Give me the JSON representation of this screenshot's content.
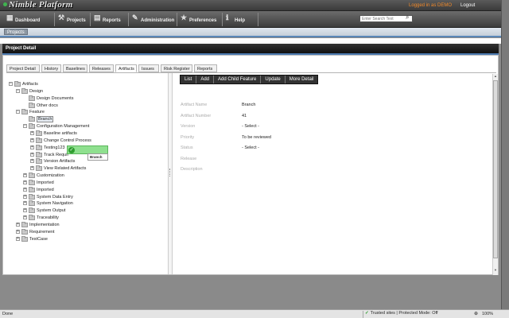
{
  "app": {
    "logo": "Nimble Platform",
    "login_info": "Logged in as DEMO",
    "logout": "Logout"
  },
  "nav": [
    {
      "label": "Dashboard",
      "icon": "dashboard-icon",
      "glyph": "▦"
    },
    {
      "label": "Projects",
      "icon": "projects-icon",
      "glyph": "⚒"
    },
    {
      "label": "Reports",
      "icon": "reports-icon",
      "glyph": "▤"
    },
    {
      "label": "Administration",
      "icon": "administration-icon",
      "glyph": "✎"
    },
    {
      "label": "Preferences",
      "icon": "preferences-icon",
      "glyph": "★"
    },
    {
      "label": "Help",
      "icon": "help-icon",
      "glyph": "ℹ"
    }
  ],
  "search": {
    "placeholder": "Enter Search Text"
  },
  "breadcrumb": {
    "current": "Projects"
  },
  "panel": {
    "title": "Project Detail"
  },
  "tabs": [
    {
      "label": "Project Detail"
    },
    {
      "label": "History"
    },
    {
      "label": "Baselines"
    },
    {
      "label": "Releases"
    },
    {
      "label": "Artifacts",
      "active": true
    },
    {
      "label": "Issues"
    },
    {
      "label": "Risk Register"
    },
    {
      "label": "Reports"
    }
  ],
  "tree": [
    {
      "label": "Artifacts",
      "level": 0,
      "toggle": "−"
    },
    {
      "label": "Design",
      "level": 1,
      "toggle": "−"
    },
    {
      "label": "Design Documents",
      "level": 2,
      "toggle": ""
    },
    {
      "label": "Other docs",
      "level": 2,
      "toggle": ""
    },
    {
      "label": "Feature",
      "level": 1,
      "toggle": "−"
    },
    {
      "label": "Branch",
      "level": 2,
      "toggle": "",
      "selected": true
    },
    {
      "label": "Configuration Management",
      "level": 2,
      "toggle": "−"
    },
    {
      "label": "Baseline artifacts",
      "level": 3,
      "toggle": "+"
    },
    {
      "label": "Change Control Process",
      "level": 3,
      "toggle": "+"
    },
    {
      "label": "Testing123",
      "level": 3,
      "toggle": "+"
    },
    {
      "label": "Track Requir",
      "level": 3,
      "toggle": "+"
    },
    {
      "label": "Version Artifacts",
      "level": 3,
      "toggle": "+"
    },
    {
      "label": "View Related Artifacts",
      "level": 3,
      "toggle": "+"
    },
    {
      "label": "Customization",
      "level": 2,
      "toggle": "+"
    },
    {
      "label": "Imported",
      "level": 2,
      "toggle": "+"
    },
    {
      "label": "Imported",
      "level": 2,
      "toggle": "+"
    },
    {
      "label": "System Data Entry",
      "level": 2,
      "toggle": "+"
    },
    {
      "label": "System Navigation",
      "level": 2,
      "toggle": "+"
    },
    {
      "label": "System Output",
      "level": 2,
      "toggle": "+"
    },
    {
      "label": "Traceability",
      "level": 2,
      "toggle": "+"
    },
    {
      "label": "Implementation",
      "level": 1,
      "toggle": "+"
    },
    {
      "label": "Requirement",
      "level": 1,
      "toggle": "+"
    },
    {
      "label": "TestCase",
      "level": 1,
      "toggle": "+"
    }
  ],
  "drag": {
    "tip": "Branch"
  },
  "toolbar": [
    {
      "label": "List",
      "name": "list-button"
    },
    {
      "label": "Add",
      "name": "add-button"
    },
    {
      "label": "Add Child Feature",
      "name": "add-child-feature-button"
    },
    {
      "label": "Update",
      "name": "update-button"
    },
    {
      "label": "More Detail",
      "name": "more-detail-button"
    }
  ],
  "fields": [
    {
      "label": "Artifact Name",
      "value": "Branch"
    },
    {
      "label": "Artifact Number",
      "value": "41"
    },
    {
      "label": "Version",
      "value": "- Select -"
    },
    {
      "label": "Priority",
      "value": "To be reviewed"
    },
    {
      "label": "Status",
      "value": "- Select -"
    },
    {
      "label": "Release",
      "value": ""
    },
    {
      "label": "Description",
      "value": ""
    }
  ],
  "status": {
    "left": "Done",
    "zone": "Trusted sites | Protected Mode: Off",
    "zoom": "100%"
  },
  "colors": {
    "accent": "#4b7ab0",
    "login": "#f28a2a",
    "drag": "#8fe08f"
  }
}
